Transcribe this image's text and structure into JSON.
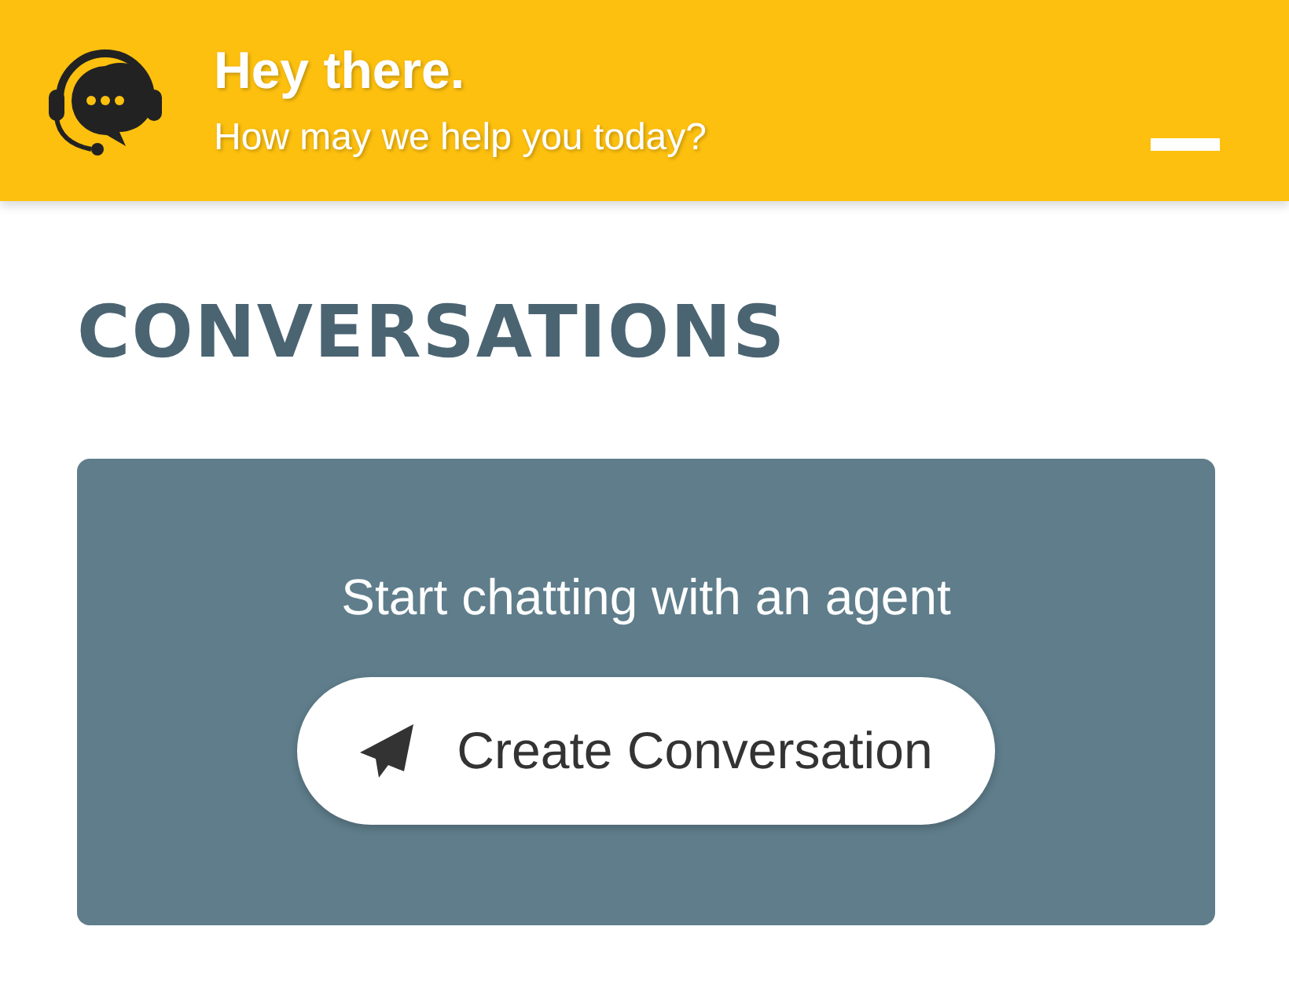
{
  "header": {
    "title": "Hey there.",
    "subtitle": "How may we help you today?"
  },
  "section": {
    "title": "CONVERSATIONS"
  },
  "card": {
    "text": "Start chatting with an agent",
    "button": "Create Conversation"
  }
}
